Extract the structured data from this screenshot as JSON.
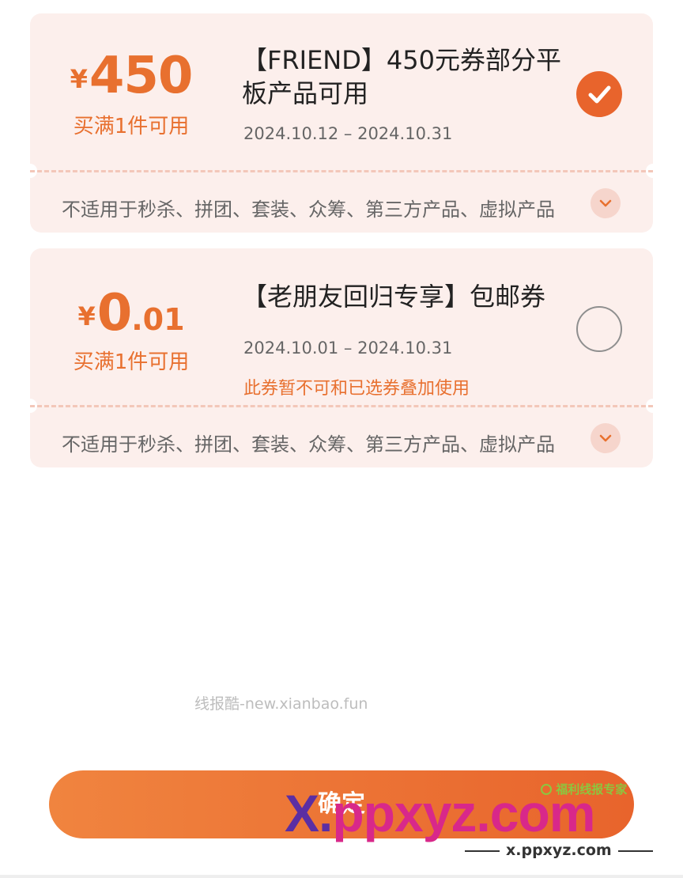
{
  "coupons": [
    {
      "currency": "¥",
      "amount_int": "450",
      "amount_dec": "",
      "condition": "买满1件可用",
      "title": "【FRIEND】450元券部分平板产品可用",
      "validity": "2024.10.12 – 2024.10.31",
      "notice": "",
      "selected": true,
      "restriction": "不适用于秒杀、拼团、套装、众筹、第三方产品、虚拟产品"
    },
    {
      "currency": "¥",
      "amount_int": "0",
      "amount_dec": ".01",
      "condition": "买满1件可用",
      "title": "【老朋友回归专享】包邮券",
      "validity": "2024.10.01 – 2024.10.31",
      "notice": "此券暂不可和已选券叠加使用",
      "selected": false,
      "restriction": "不适用于秒杀、拼团、套装、众筹、第三方产品、虚拟产品"
    }
  ],
  "confirm_label": "确定",
  "watermarks": {
    "site_text": "线报酷-new.xianbao.fun",
    "big_logo_x": "X.",
    "big_logo_rest": "ppxyz.com",
    "brand": "福利线报专家",
    "domain": "x.ppxyz.com"
  },
  "colors": {
    "accent": "#e8702f",
    "card_bg": "#fcefec",
    "check_on": "#e8642c"
  }
}
